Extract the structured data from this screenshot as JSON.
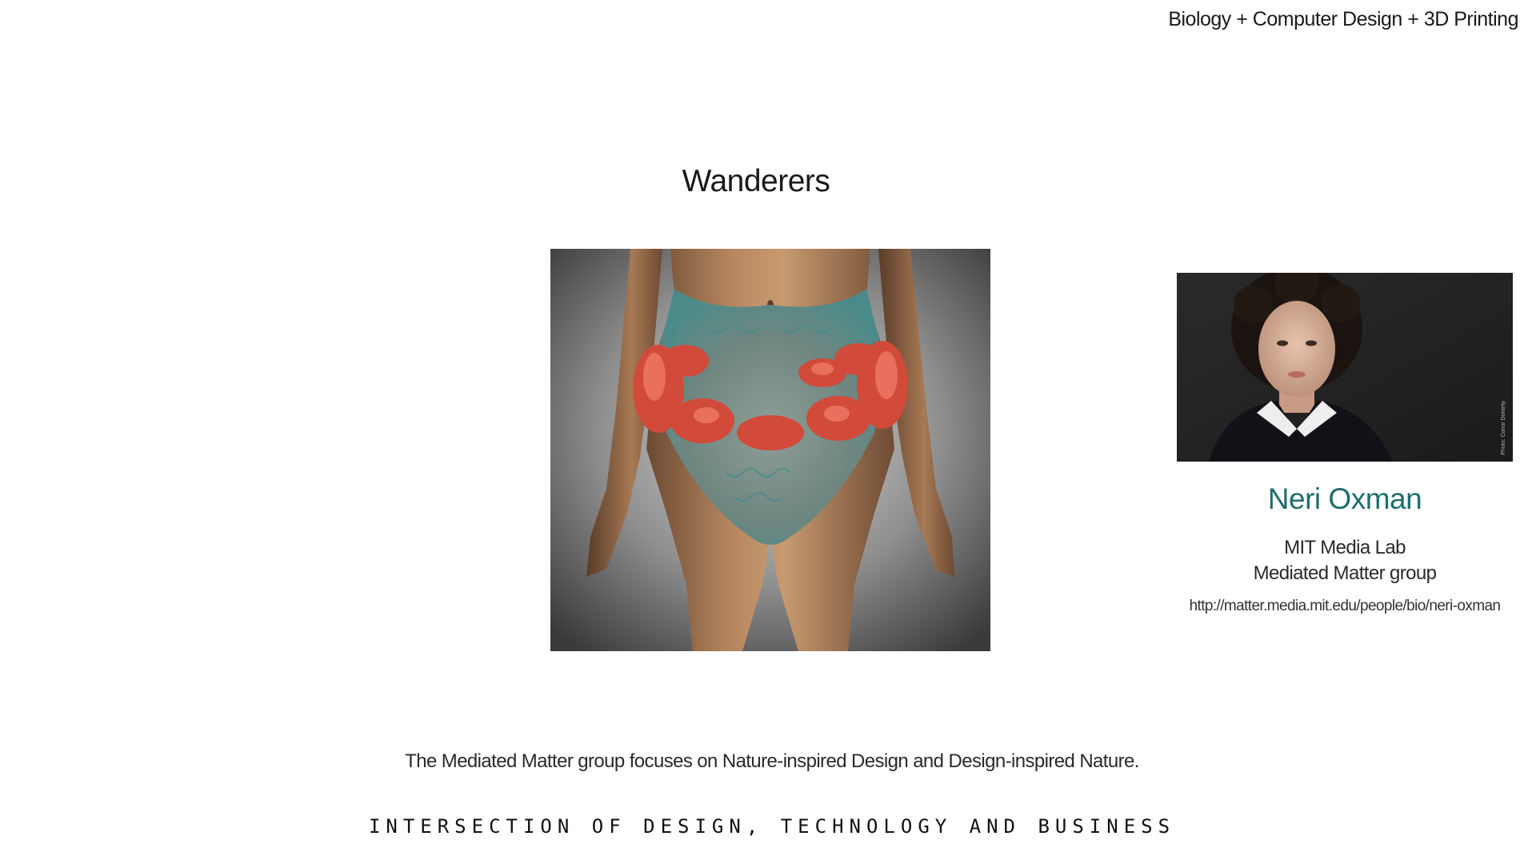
{
  "header": {
    "topic": "Biology + Computer Design + 3D Printing"
  },
  "main": {
    "title": "Wanderers",
    "photo_subject": "3D-printed wearable artwork"
  },
  "profile": {
    "name": "Neri Oxman",
    "affiliation_line_1": "MIT Media Lab",
    "affiliation_line_2": "Mediated Matter group",
    "url": "http://matter.media.mit.edu/people/bio/neri-oxman",
    "photo_credit": "Photo: Conor Doherty",
    "accent_color": "#1f6e6c"
  },
  "footer": {
    "description": "The Mediated Matter group focuses on Nature-inspired Design and Design-inspired Nature.",
    "tagline": "INTERSECTION OF DESIGN, TECHNOLOGY AND BUSINESS"
  }
}
